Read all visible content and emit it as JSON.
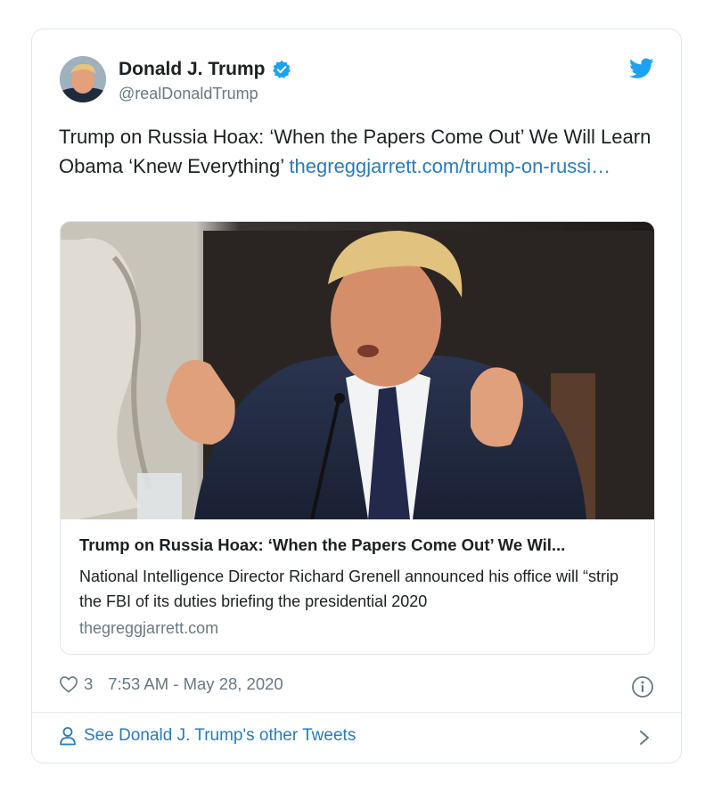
{
  "author": {
    "name": "Donald J. Trump",
    "handle": "@realDonaldTrump"
  },
  "tweet": {
    "text": "Trump on Russia Hoax: ‘When the Papers Come Out’ We Will Learn Obama ‘Knew Everything’ ",
    "link_text": "thegreggjarrett.com/trump-on-russi…"
  },
  "card": {
    "title": "Trump on Russia Hoax: ‘When the Papers Come Out’ We Wil...",
    "description": "National Intelligence Director Richard Grenell announced his office will “strip the FBI of its duties briefing the presidential 2020",
    "domain": "thegreggjarrett.com"
  },
  "meta": {
    "like_count": "3",
    "timestamp": "7:53 AM - May 28, 2020"
  },
  "footer": {
    "other_tweets_label": "See Donald J. Trump's other Tweets"
  },
  "colors": {
    "link": "#2b7bb9",
    "muted": "#697882",
    "border": "#e1e8ed",
    "twitter_blue": "#1da1f2"
  },
  "icons": [
    "verified-badge-icon",
    "twitter-bird-icon",
    "heart-icon",
    "info-icon",
    "person-icon",
    "chevron-right-icon"
  ]
}
